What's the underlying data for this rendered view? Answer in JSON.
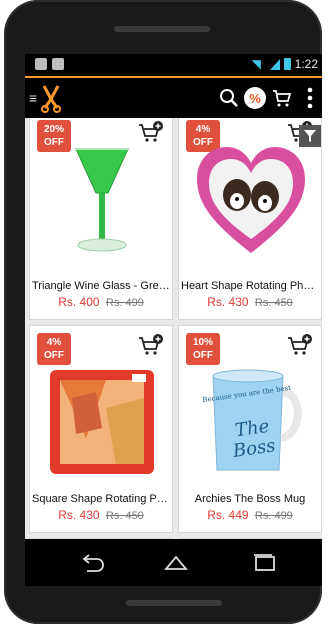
{
  "status": {
    "time": "1:22"
  },
  "appbar": {
    "offer_symbol": "%"
  },
  "products": [
    {
      "name": "Triangle Wine Glass - Green",
      "price": "Rs. 400",
      "old_price": "Rs. 499",
      "discount_pct": "20%",
      "discount_label": "OFF"
    },
    {
      "name": "Heart Shape Rotating Phot...",
      "price": "Rs. 430",
      "old_price": "Rs. 450",
      "discount_pct": "4%",
      "discount_label": "OFF"
    },
    {
      "name": "Square Shape Rotating Ph...",
      "price": "Rs. 430",
      "old_price": "Rs. 450",
      "discount_pct": "4%",
      "discount_label": "OFF"
    },
    {
      "name": "Archies The Boss Mug",
      "price": "Rs. 449",
      "old_price": "Rs. 499",
      "discount_pct": "10%",
      "discount_label": "OFF"
    }
  ],
  "mug_text": {
    "line1": "Because you are the best",
    "line2": "The",
    "line3": "Boss"
  },
  "icons": {
    "menu": "menu-icon",
    "logo": "scissors-logo-icon",
    "search": "search-icon",
    "offer": "offer-icon",
    "cart": "cart-icon",
    "more": "more-vertical-icon",
    "add_cart": "add-to-cart-icon",
    "filter": "filter-icon",
    "back": "back-icon",
    "home": "home-icon",
    "recent": "recent-apps-icon"
  },
  "colors": {
    "accent": "#ff9a2a",
    "badge": "#e0503a",
    "price": "#e53935"
  }
}
